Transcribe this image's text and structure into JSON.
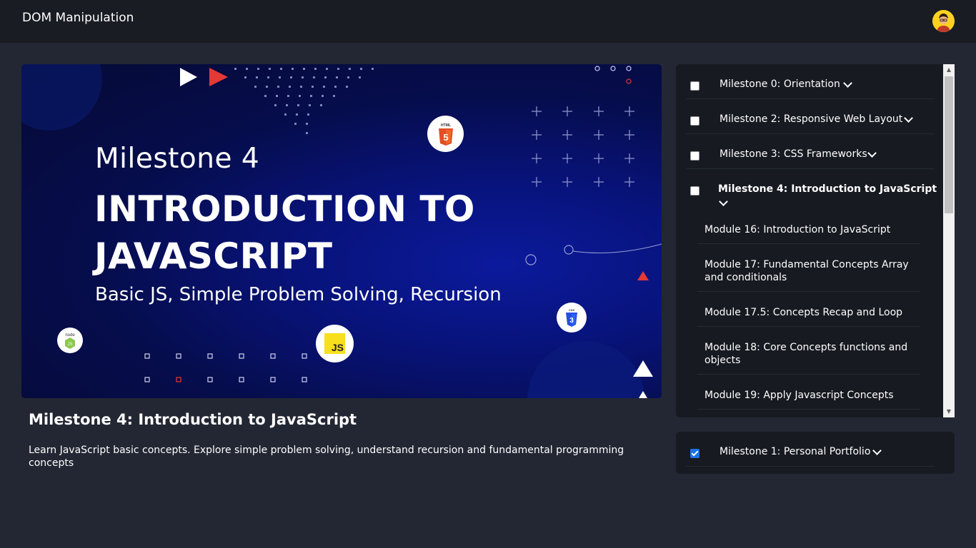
{
  "app": {
    "title": "DOM Manipulation"
  },
  "banner": {
    "milestone_line": "Milestone 4",
    "title": "INTRODUCTION TO JAVASCRIPT",
    "tagline": "Basic JS, Simple Problem Solving, Recursion",
    "badges": [
      "html5-icon",
      "css3-icon",
      "nodejs-icon",
      "javascript-icon"
    ],
    "badge_text": {
      "html": "HTML",
      "css": "CSS",
      "js": "JS",
      "node": "node"
    }
  },
  "lesson": {
    "title": "Milestone 4: Introduction to JavaScript",
    "description": "Learn JavaScript basic concepts. Explore simple problem solving, understand recursion and fundamental programming concepts"
  },
  "milestones": [
    {
      "label": "Milestone 0: Orientation",
      "checked": false,
      "expanded": false
    },
    {
      "label": "Milestone 2: Responsive Web Layout",
      "checked": false,
      "expanded": false
    },
    {
      "label": "Milestone 3: CSS Frameworks",
      "checked": false,
      "expanded": false
    },
    {
      "label": "Milestone 4: Introduction to JavaScript",
      "checked": false,
      "expanded": true
    }
  ],
  "modules": [
    "Module 16: Introduction to JavaScript",
    "Module 17: Fundamental Concepts Array and conditionals",
    "Module 17.5: Concepts Recap and Loop",
    "Module 18: Core Concepts functions and objects",
    "Module 19: Apply Javascript Concepts"
  ],
  "completed": [
    {
      "label": "Milestone 1: Personal Portfolio",
      "checked": true
    }
  ],
  "colors": {
    "background": "#222733",
    "topbar": "#191c23",
    "panel": "#171a21",
    "accent": "#1a73e8"
  }
}
